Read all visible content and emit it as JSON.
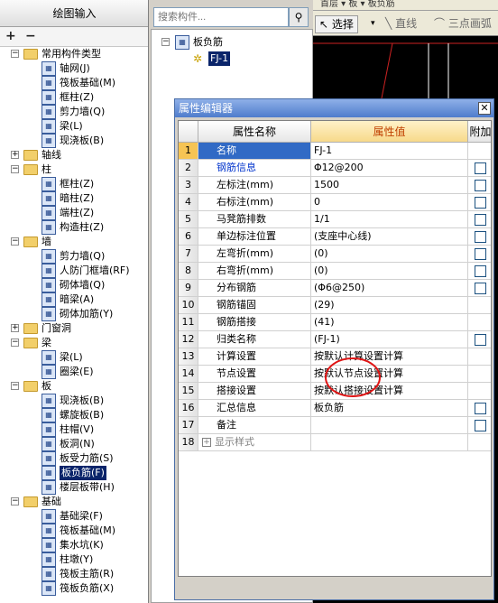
{
  "left": {
    "header": "绘图输入",
    "add_icon": "+",
    "remove_icon": "−",
    "tree": [
      {
        "text": "常用构件类型",
        "level": 0,
        "kind": "folder",
        "exp": "-"
      },
      {
        "text": "轴网(J)",
        "level": 1,
        "kind": "item"
      },
      {
        "text": "筏板基础(M)",
        "level": 1,
        "kind": "item"
      },
      {
        "text": "框柱(Z)",
        "level": 1,
        "kind": "item"
      },
      {
        "text": "剪力墙(Q)",
        "level": 1,
        "kind": "item"
      },
      {
        "text": "梁(L)",
        "level": 1,
        "kind": "item"
      },
      {
        "text": "现浇板(B)",
        "level": 1,
        "kind": "item"
      },
      {
        "text": "轴线",
        "level": 0,
        "kind": "folder",
        "exp": "+"
      },
      {
        "text": "柱",
        "level": 0,
        "kind": "folder",
        "exp": "-"
      },
      {
        "text": "框柱(Z)",
        "level": 1,
        "kind": "item"
      },
      {
        "text": "暗柱(Z)",
        "level": 1,
        "kind": "item"
      },
      {
        "text": "端柱(Z)",
        "level": 1,
        "kind": "item"
      },
      {
        "text": "构造柱(Z)",
        "level": 1,
        "kind": "item"
      },
      {
        "text": "墙",
        "level": 0,
        "kind": "folder",
        "exp": "-"
      },
      {
        "text": "剪力墙(Q)",
        "level": 1,
        "kind": "item"
      },
      {
        "text": "人防门框墙(RF)",
        "level": 1,
        "kind": "item"
      },
      {
        "text": "砌体墙(Q)",
        "level": 1,
        "kind": "item"
      },
      {
        "text": "暗梁(A)",
        "level": 1,
        "kind": "item"
      },
      {
        "text": "砌体加筋(Y)",
        "level": 1,
        "kind": "item"
      },
      {
        "text": "门窗洞",
        "level": 0,
        "kind": "folder",
        "exp": "+"
      },
      {
        "text": "梁",
        "level": 0,
        "kind": "folder",
        "exp": "-"
      },
      {
        "text": "梁(L)",
        "level": 1,
        "kind": "item"
      },
      {
        "text": "圈梁(E)",
        "level": 1,
        "kind": "item"
      },
      {
        "text": "板",
        "level": 0,
        "kind": "folder",
        "exp": "-"
      },
      {
        "text": "现浇板(B)",
        "level": 1,
        "kind": "item"
      },
      {
        "text": "螺旋板(B)",
        "level": 1,
        "kind": "item"
      },
      {
        "text": "柱帽(V)",
        "level": 1,
        "kind": "item"
      },
      {
        "text": "板洞(N)",
        "level": 1,
        "kind": "item"
      },
      {
        "text": "板受力筋(S)",
        "level": 1,
        "kind": "item"
      },
      {
        "text": "板负筋(F)",
        "level": 1,
        "kind": "item",
        "selected": true
      },
      {
        "text": "楼层板带(H)",
        "level": 1,
        "kind": "item"
      },
      {
        "text": "基础",
        "level": 0,
        "kind": "folder",
        "exp": "-"
      },
      {
        "text": "基础梁(F)",
        "level": 1,
        "kind": "item"
      },
      {
        "text": "筏板基础(M)",
        "level": 1,
        "kind": "item"
      },
      {
        "text": "集水坑(K)",
        "level": 1,
        "kind": "item"
      },
      {
        "text": "柱墩(Y)",
        "level": 1,
        "kind": "item"
      },
      {
        "text": "筏板主筋(R)",
        "level": 1,
        "kind": "item"
      },
      {
        "text": "筏板负筋(X)",
        "level": 1,
        "kind": "item"
      }
    ]
  },
  "search": {
    "placeholder": "搜索构件..."
  },
  "mid": {
    "parent": "板负筋",
    "child": "FJ-1"
  },
  "toolbar": {
    "top_items": "首层  ▾  板  ▾  板负筋",
    "select_label": "选择",
    "line_label": "直线",
    "arc_label": "三点画弧"
  },
  "dialog": {
    "title": "属性编辑器",
    "headers": {
      "name": "属性名称",
      "value": "属性值",
      "extra": "附加"
    },
    "rows": [
      {
        "num": "1",
        "name": "名称",
        "value": "FJ-1",
        "checkbox": false,
        "blue": false,
        "selected": true
      },
      {
        "num": "2",
        "name": "钢筋信息",
        "value": "Φ12@200",
        "checkbox": true,
        "blue": true
      },
      {
        "num": "3",
        "name": "左标注(mm)",
        "value": "1500",
        "checkbox": true,
        "blue": false
      },
      {
        "num": "4",
        "name": "右标注(mm)",
        "value": "0",
        "checkbox": true,
        "blue": false
      },
      {
        "num": "5",
        "name": "马凳筋排数",
        "value": "1/1",
        "checkbox": true,
        "blue": false
      },
      {
        "num": "6",
        "name": "单边标注位置",
        "value": "(支座中心线)",
        "checkbox": true,
        "blue": false
      },
      {
        "num": "7",
        "name": "左弯折(mm)",
        "value": "(0)",
        "checkbox": true,
        "blue": false
      },
      {
        "num": "8",
        "name": "右弯折(mm)",
        "value": "(0)",
        "checkbox": true,
        "blue": false
      },
      {
        "num": "9",
        "name": "分布钢筋",
        "value": "(Φ6@250)",
        "checkbox": true,
        "blue": false
      },
      {
        "num": "10",
        "name": "钢筋锚固",
        "value": "(29)",
        "checkbox": false,
        "blue": false
      },
      {
        "num": "11",
        "name": "钢筋搭接",
        "value": "(41)",
        "checkbox": false,
        "blue": false
      },
      {
        "num": "12",
        "name": "归类名称",
        "value": "(FJ-1)",
        "checkbox": true,
        "blue": false
      },
      {
        "num": "13",
        "name": "计算设置",
        "value": "按默认计算设置计算",
        "checkbox": false,
        "blue": false
      },
      {
        "num": "14",
        "name": "节点设置",
        "value": "按默认节点设置计算",
        "checkbox": false,
        "blue": false
      },
      {
        "num": "15",
        "name": "搭接设置",
        "value": "按默认搭接设置计算",
        "checkbox": false,
        "blue": false
      },
      {
        "num": "16",
        "name": "汇总信息",
        "value": "板负筋",
        "checkbox": true,
        "blue": false
      },
      {
        "num": "17",
        "name": "备注",
        "value": "",
        "checkbox": true,
        "blue": false
      },
      {
        "num": "18",
        "name": "显示样式",
        "value": "",
        "checkbox": false,
        "blue": false,
        "expandable": true
      }
    ]
  },
  "colors": {
    "annotation": "#e01515",
    "selection": "#0a246a",
    "dialog_title": "#4e7ccc"
  }
}
